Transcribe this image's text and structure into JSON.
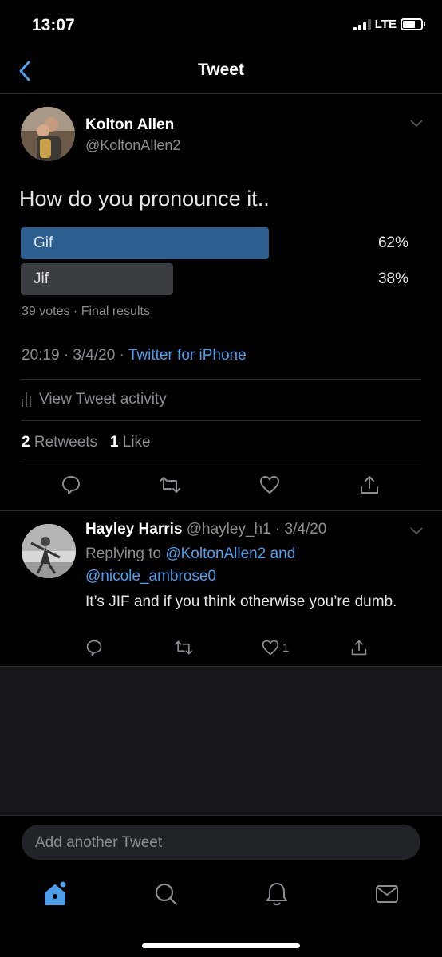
{
  "status_bar": {
    "time": "13:07",
    "network": "LTE"
  },
  "nav": {
    "title": "Tweet"
  },
  "tweet": {
    "author_name": "Kolton Allen",
    "author_handle": "@KoltonAllen2",
    "text": "How do you pronounce it..",
    "poll": {
      "options": [
        {
          "label": "Gif",
          "percent": "62%",
          "fraction": 0.62,
          "winner": true
        },
        {
          "label": "Jif",
          "percent": "38%",
          "fraction": 0.38,
          "winner": false
        }
      ],
      "meta": "39 votes · Final results"
    },
    "timestamp": "20:19 · 3/4/20 · ",
    "source": "Twitter for iPhone",
    "activity_label": "View Tweet activity",
    "retweets_count": "2",
    "retweets_label": "Retweets",
    "likes_count": "1",
    "likes_label": "Like"
  },
  "reply": {
    "author_name": "Hayley Harris",
    "author_meta": "@hayley_h1 · 3/4/20",
    "replying_prefix": "Replying to",
    "replying_to_1": "@KoltonAllen2",
    "replying_and": "and",
    "replying_to_2": "@nicole_ambrose0",
    "text": "It’s JIF and if you think otherwise you’re dumb.",
    "like_count": "1"
  },
  "composer": {
    "placeholder": "Add another Tweet"
  },
  "tabs": [
    "home-icon",
    "search-icon",
    "notifications-icon",
    "messages-icon"
  ],
  "colors": {
    "accent": "#4d9fec",
    "poll_winner": "#2c5f8f",
    "poll_other": "#3a3d41"
  }
}
